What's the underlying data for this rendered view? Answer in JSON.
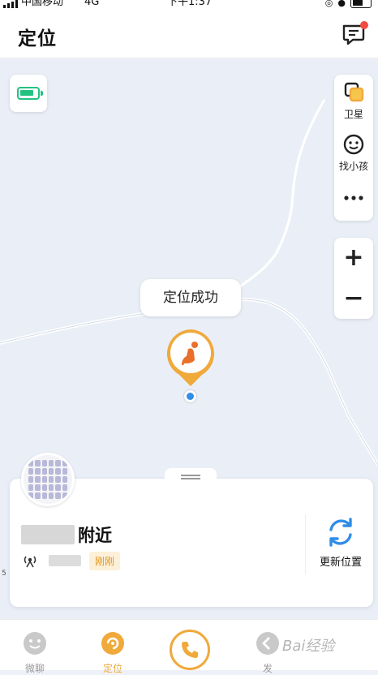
{
  "status_bar": {
    "carrier": "中国移动",
    "network": "4G",
    "time": "下午1:37"
  },
  "header": {
    "title": "定位"
  },
  "map": {
    "status_bubble": "定位成功",
    "tools": [
      {
        "icon": "satellite-icon",
        "label": "卫星"
      },
      {
        "icon": "find-child-icon",
        "label": "找小孩"
      },
      {
        "icon": "more-icon",
        "label": ""
      }
    ],
    "zoom_in": "+",
    "zoom_out": "−",
    "scale_label": "5"
  },
  "location_card": {
    "place_suffix": "附近",
    "time_badge": "刚刚",
    "refresh_label": "更新位置"
  },
  "tabs": [
    {
      "label": "微聊",
      "active": false
    },
    {
      "label": "定位",
      "active": true
    },
    {
      "label": "",
      "active": false
    },
    {
      "label": "发",
      "active": false
    }
  ],
  "watermark": "Bai经验",
  "colors": {
    "accent": "#f0a93b",
    "battery": "#23c281",
    "location_dot": "#2f8ee8",
    "badge_bg": "#fdf0d8"
  }
}
